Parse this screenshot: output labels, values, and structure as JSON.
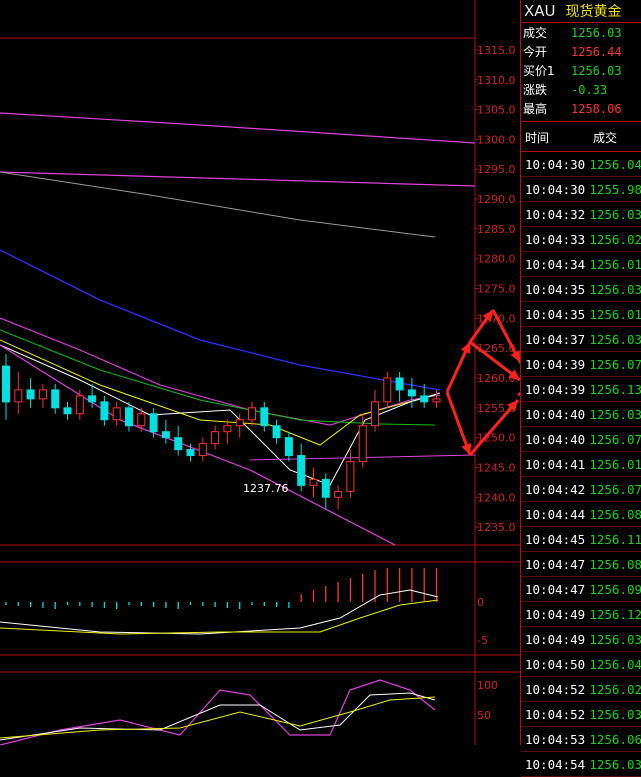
{
  "quote": {
    "symbol": "XAU",
    "name": "现货黄金",
    "rows": [
      {
        "label": "成交",
        "value": "1256.03",
        "color": "#19d219"
      },
      {
        "label": "今开",
        "value": "1256.44",
        "color": "#ff3030"
      },
      {
        "label": "买价1",
        "value": "1256.03",
        "color": "#19d219"
      },
      {
        "label": "涨跌",
        "value": "-0.33",
        "color": "#19d219"
      },
      {
        "label": "最高",
        "value": "1258.06",
        "color": "#ff3030"
      }
    ]
  },
  "ticks": {
    "header_time": "时间",
    "header_price": "成交",
    "rows": [
      {
        "time": "10:04:30",
        "price": "1256.04",
        "dir": "dn"
      },
      {
        "time": "10:04:30",
        "price": "1255.98",
        "dir": "dn"
      },
      {
        "time": "10:04:32",
        "price": "1256.03",
        "dir": "dn"
      },
      {
        "time": "10:04:33",
        "price": "1256.02",
        "dir": "dn"
      },
      {
        "time": "10:04:34",
        "price": "1256.01",
        "dir": "dn"
      },
      {
        "time": "10:04:35",
        "price": "1256.03",
        "dir": "dn"
      },
      {
        "time": "10:04:35",
        "price": "1256.01",
        "dir": "dn"
      },
      {
        "time": "10:04:37",
        "price": "1256.03",
        "dir": "dn"
      },
      {
        "time": "10:04:39",
        "price": "1256.07",
        "dir": "dn"
      },
      {
        "time": "10:04:39",
        "price": "1256.13",
        "dir": "dn"
      },
      {
        "time": "10:04:40",
        "price": "1256.03",
        "dir": "dn"
      },
      {
        "time": "10:04:40",
        "price": "1256.07",
        "dir": "dn"
      },
      {
        "time": "10:04:41",
        "price": "1256.01",
        "dir": "dn"
      },
      {
        "time": "10:04:42",
        "price": "1256.07",
        "dir": "dn"
      },
      {
        "time": "10:04:44",
        "price": "1256.08",
        "dir": "dn"
      },
      {
        "time": "10:04:45",
        "price": "1256.11",
        "dir": "dn"
      },
      {
        "time": "10:04:47",
        "price": "1256.08",
        "dir": "dn"
      },
      {
        "time": "10:04:47",
        "price": "1256.09",
        "dir": "dn"
      },
      {
        "time": "10:04:49",
        "price": "1256.12",
        "dir": "dn"
      },
      {
        "time": "10:04:49",
        "price": "1256.03",
        "dir": "dn"
      },
      {
        "time": "10:04:50",
        "price": "1256.04",
        "dir": "dn"
      },
      {
        "time": "10:04:52",
        "price": "1256.02",
        "dir": "dn"
      },
      {
        "time": "10:04:52",
        "price": "1256.03",
        "dir": "dn"
      },
      {
        "time": "10:04:53",
        "price": "1256.06",
        "dir": "dn"
      },
      {
        "time": "10:04:54",
        "price": "1256.03",
        "dir": "dn"
      }
    ]
  },
  "main_axis": {
    "labels": [
      "1315.0",
      "1310.0",
      "1305.0",
      "1300.0",
      "1295.0",
      "1290.0",
      "1285.0",
      "1280.0",
      "1275.0",
      "1270.0",
      "1265.0",
      "1260.0",
      "1255.0",
      "1250.0",
      "1245.0",
      "1240.0",
      "1235.0"
    ]
  },
  "low_marker": "1237.76",
  "macd_axis": {
    "labels": [
      "0",
      "-5"
    ]
  },
  "kdj_axis": {
    "labels": [
      "100",
      "50"
    ]
  },
  "colors": {
    "up": "#ff3030",
    "down": "#19d219",
    "grid": "#b01010",
    "axis_text": "#d02020"
  },
  "chart_data": {
    "type": "candlestick",
    "ylim": [
      1232,
      1317
    ],
    "candles": [
      [
        1262,
        1264,
        1253,
        1256
      ],
      [
        1256,
        1261,
        1254,
        1258
      ],
      [
        1258,
        1260,
        1255,
        1256.5
      ],
      [
        1256.5,
        1259,
        1255,
        1258
      ],
      [
        1258,
        1259,
        1254,
        1255
      ],
      [
        1255,
        1256,
        1253,
        1254
      ],
      [
        1254,
        1258,
        1253,
        1257
      ],
      [
        1257,
        1259,
        1255,
        1256
      ],
      [
        1256,
        1257,
        1252,
        1253
      ],
      [
        1253,
        1256,
        1252,
        1255
      ],
      [
        1255,
        1256,
        1251,
        1252
      ],
      [
        1252,
        1255,
        1251,
        1254
      ],
      [
        1254,
        1255,
        1250,
        1251
      ],
      [
        1251,
        1253,
        1249,
        1250
      ],
      [
        1250,
        1252,
        1247,
        1248
      ],
      [
        1248,
        1249,
        1246,
        1247
      ],
      [
        1247,
        1250,
        1246,
        1249
      ],
      [
        1249,
        1252,
        1248,
        1251
      ],
      [
        1251,
        1253,
        1249,
        1252
      ],
      [
        1252,
        1254,
        1250,
        1253
      ],
      [
        1253,
        1256,
        1252,
        1255
      ],
      [
        1255,
        1256,
        1251,
        1252
      ],
      [
        1252,
        1253,
        1249,
        1250
      ],
      [
        1250,
        1251,
        1246,
        1247
      ],
      [
        1247,
        1249,
        1241,
        1242
      ],
      [
        1242,
        1245,
        1240,
        1243
      ],
      [
        1243,
        1244,
        1238,
        1240
      ],
      [
        1240,
        1242,
        1238,
        1241
      ],
      [
        1241,
        1248,
        1240,
        1246
      ],
      [
        1246,
        1254,
        1245,
        1252
      ],
      [
        1252,
        1258,
        1251,
        1256
      ],
      [
        1256,
        1261,
        1255,
        1260
      ],
      [
        1260,
        1261,
        1256,
        1258
      ],
      [
        1258,
        1260,
        1255,
        1257
      ],
      [
        1257,
        1259,
        1255,
        1256
      ],
      [
        1256,
        1258,
        1255,
        1256.5
      ]
    ]
  }
}
